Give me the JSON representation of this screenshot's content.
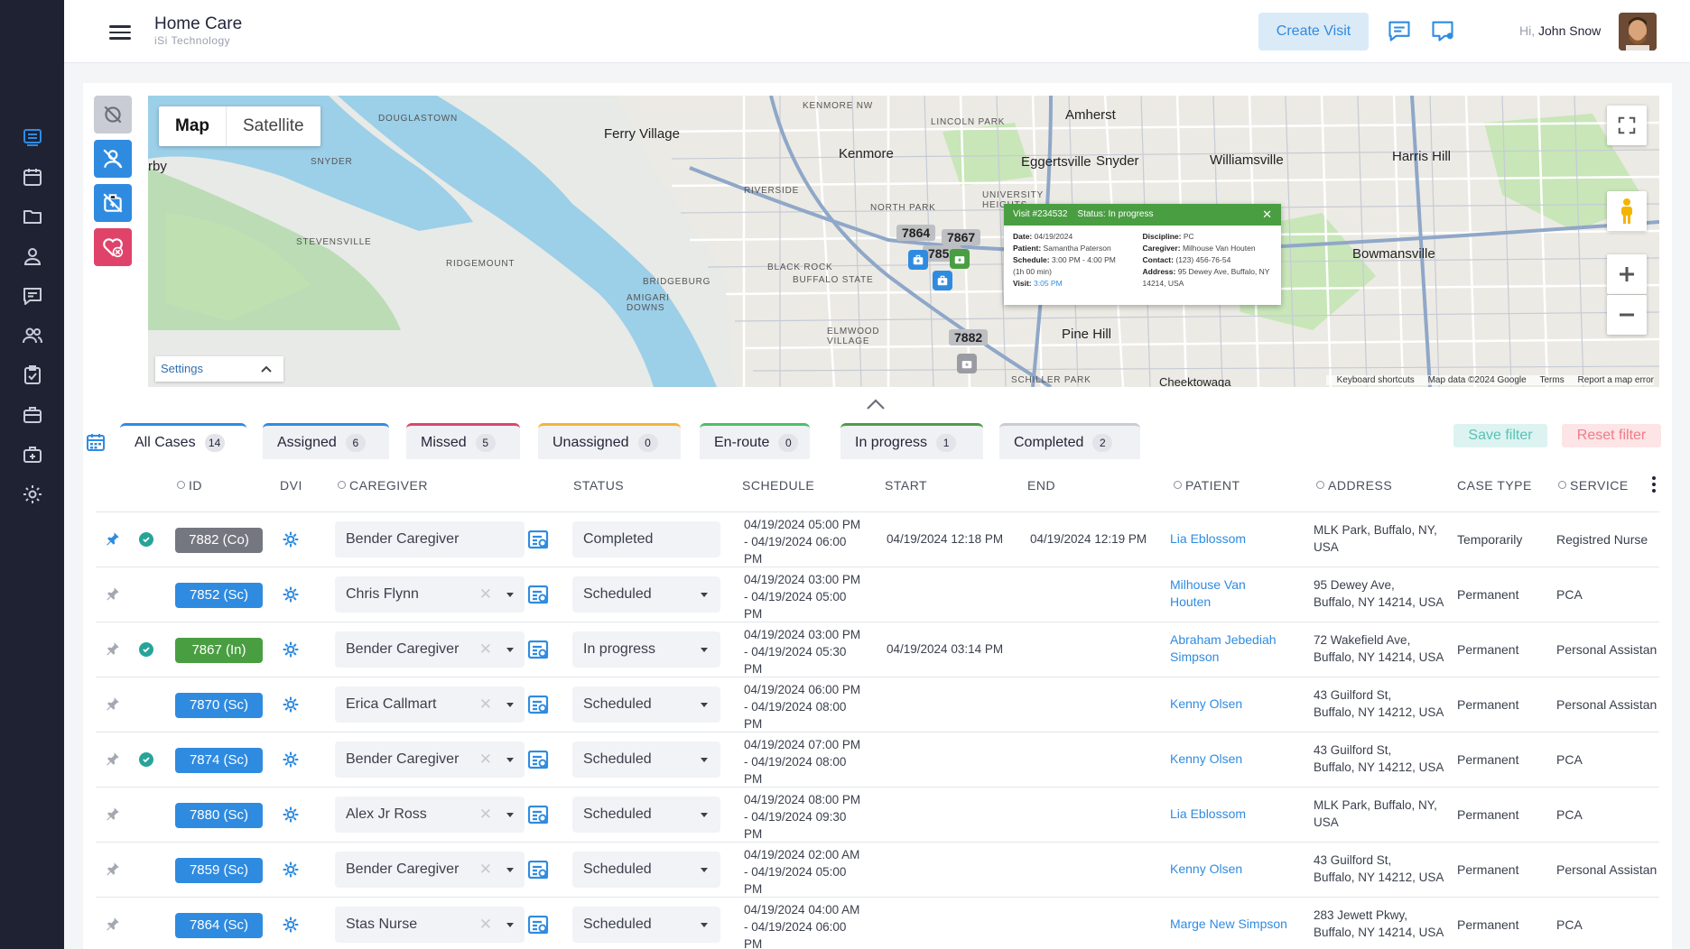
{
  "app": {
    "title": "Home Care",
    "subtitle": "iSi Technology"
  },
  "header": {
    "create_visit": "Create Visit",
    "greeting": "Hi,",
    "user_name": "John Snow"
  },
  "colors": {
    "sidebar_bg": "#1f2233",
    "accent": "#2f8be0",
    "completed": "#757780",
    "scheduled": "#2f8be0",
    "in_progress": "#4a9e42"
  },
  "sidebar": {
    "items": [
      {
        "icon": "chat-list-icon",
        "active": true
      },
      {
        "icon": "calendar-icon"
      },
      {
        "icon": "folder-icon"
      },
      {
        "icon": "user-icon"
      },
      {
        "icon": "messages-icon"
      },
      {
        "icon": "users-icon"
      },
      {
        "icon": "clipboard-check-icon"
      },
      {
        "icon": "briefcase-icon"
      },
      {
        "icon": "medical-kit-icon"
      },
      {
        "icon": "gear-icon"
      }
    ]
  },
  "map": {
    "type_map": "Map",
    "type_satellite": "Satellite",
    "settings": "Settings",
    "labels": [
      "Ferry Village",
      "Kenmore",
      "Amherst",
      "Eggertsville",
      "Snyder",
      "Williamsville",
      "Harris Hill",
      "Bowmansville",
      "Pine Hill",
      "Cheektowaga",
      "rby"
    ],
    "small_labels": [
      "DOUGLASTOWN",
      "SNYDER",
      "STEVENSVILLE",
      "RIDGEMOUNT",
      "BRIDGEBURG",
      "AMIGARI DOWNS",
      "KENMORE NW",
      "LINCOLN PARK",
      "RIVERSIDE",
      "NORTH PARK",
      "UNIVERSITY HEIGHTS",
      "BLACK ROCK",
      "BUFFALO STATE",
      "ELMWOOD VILLAGE",
      "SCHILLER PARK"
    ],
    "markers": [
      "7864",
      "7867",
      "7852",
      "7882"
    ],
    "attribution": [
      "Keyboard shortcuts",
      "Map data ©2024 Google",
      "Terms",
      "Report a map error"
    ],
    "popup": {
      "title": "Visit #234532",
      "status": "Status: In progress",
      "date_label": "Date:",
      "date": "04/19/2024",
      "patient_label": "Patient:",
      "patient": "Samantha Paterson",
      "schedule_label": "Schedule:",
      "schedule": "3:00 PM - 4:00 PM",
      "duration": "(1h 00 min)",
      "visit_label": "Visit:",
      "visit": "3:05 PM",
      "discipline_label": "Discipline:",
      "discipline": "PC",
      "caregiver_label": "Caregiver:",
      "caregiver": "Milhouse Van Houten",
      "contact_label": "Contact:",
      "contact": "(123) 456-76-54",
      "address_label": "Address:",
      "address": "95 Dewey Ave, Buffalo, NY 14214, USA"
    }
  },
  "tabs": [
    {
      "label": "All Cases",
      "count": "14",
      "color": "#2f8be0"
    },
    {
      "label": "Assigned",
      "count": "6",
      "color": "#2f8be0"
    },
    {
      "label": "Missed",
      "count": "5",
      "color": "#e0436a"
    },
    {
      "label": "Unassigned",
      "count": "0",
      "color": "#f2b632"
    },
    {
      "label": "En-route",
      "count": "0",
      "color": "#4bbf6b"
    },
    {
      "label": "In progress",
      "count": "1",
      "color": "#4a9e42"
    },
    {
      "label": "Completed",
      "count": "2",
      "color": "#c9ccd3"
    }
  ],
  "filters": {
    "save": "Save filter",
    "reset": "Reset filter"
  },
  "table": {
    "headers": {
      "id": "ID",
      "dvi": "DVI",
      "caregiver": "CAREGIVER",
      "status": "STATUS",
      "schedule": "SCHEDULE",
      "start": "START",
      "end": "END",
      "patient": "PATIENT",
      "address": "ADDRESS",
      "case_type": "CASE TYPE",
      "service": "SERVICE"
    },
    "rows": [
      {
        "pinned": true,
        "verified": true,
        "id": "7882 (Co)",
        "id_color": "#757780",
        "caregiver": "Bender Caregiver",
        "clearable": false,
        "status": "Completed",
        "status_dropdown": false,
        "schedule": [
          "04/19/2024 05:00 PM",
          "- 04/19/2024 06:00",
          "PM"
        ],
        "start": "04/19/2024 12:18 PM",
        "end": "04/19/2024 12:19 PM",
        "patient": [
          "Lia Eblossom"
        ],
        "address": [
          "MLK Park, Buffalo, NY,",
          "USA"
        ],
        "case_type": "Temporarily",
        "service": "Registred Nurse"
      },
      {
        "pinned": false,
        "verified": false,
        "id": "7852 (Sc)",
        "id_color": "#2f8be0",
        "caregiver": "Chris Flynn",
        "clearable": true,
        "status": "Scheduled",
        "status_dropdown": true,
        "schedule": [
          "04/19/2024 03:00 PM",
          "- 04/19/2024 05:00",
          "PM"
        ],
        "start": "",
        "end": "",
        "patient": [
          "Milhouse Van",
          "Houten"
        ],
        "address": [
          "95 Dewey Ave,",
          "Buffalo, NY 14214, USA"
        ],
        "case_type": "Permanent",
        "service": "PCA"
      },
      {
        "pinned": false,
        "verified": true,
        "id": "7867 (In)",
        "id_color": "#4a9e42",
        "caregiver": "Bender Caregiver",
        "clearable": true,
        "status": "In progress",
        "status_dropdown": true,
        "schedule": [
          "04/19/2024 03:00 PM",
          "- 04/19/2024 05:30",
          "PM"
        ],
        "start": "04/19/2024 03:14 PM",
        "end": "",
        "patient": [
          "Abraham Jebediah",
          "Simpson"
        ],
        "address": [
          "72 Wakefield Ave,",
          "Buffalo, NY 14214, USA"
        ],
        "case_type": "Permanent",
        "service": "Personal Assistan"
      },
      {
        "pinned": false,
        "verified": false,
        "id": "7870 (Sc)",
        "id_color": "#2f8be0",
        "caregiver": "Erica Callmart",
        "clearable": true,
        "status": "Scheduled",
        "status_dropdown": true,
        "schedule": [
          "04/19/2024 06:00 PM",
          "- 04/19/2024 08:00",
          "PM"
        ],
        "start": "",
        "end": "",
        "patient": [
          "Kenny Olsen"
        ],
        "address": [
          "43 Guilford St,",
          "Buffalo, NY 14212, USA"
        ],
        "case_type": "Permanent",
        "service": "Personal Assistan"
      },
      {
        "pinned": false,
        "verified": true,
        "id": "7874 (Sc)",
        "id_color": "#2f8be0",
        "caregiver": "Bender Caregiver",
        "clearable": true,
        "status": "Scheduled",
        "status_dropdown": true,
        "schedule": [
          "04/19/2024 07:00 PM",
          "- 04/19/2024 08:00",
          "PM"
        ],
        "start": "",
        "end": "",
        "patient": [
          "Kenny Olsen"
        ],
        "address": [
          "43 Guilford St,",
          "Buffalo, NY 14212, USA"
        ],
        "case_type": "Permanent",
        "service": "PCA"
      },
      {
        "pinned": false,
        "verified": false,
        "id": "7880 (Sc)",
        "id_color": "#2f8be0",
        "caregiver": "Alex Jr Ross",
        "clearable": true,
        "status": "Scheduled",
        "status_dropdown": true,
        "schedule": [
          "04/19/2024 08:00 PM",
          "- 04/19/2024 09:30",
          "PM"
        ],
        "start": "",
        "end": "",
        "patient": [
          "Lia Eblossom"
        ],
        "address": [
          "MLK Park, Buffalo, NY,",
          "USA"
        ],
        "case_type": "Permanent",
        "service": "PCA"
      },
      {
        "pinned": false,
        "verified": false,
        "id": "7859 (Sc)",
        "id_color": "#2f8be0",
        "caregiver": "Bender Caregiver",
        "clearable": true,
        "status": "Scheduled",
        "status_dropdown": true,
        "schedule": [
          "04/19/2024 02:00 AM",
          "- 04/19/2024 05:00",
          "PM"
        ],
        "start": "",
        "end": "",
        "patient": [
          "Kenny Olsen"
        ],
        "address": [
          "43 Guilford St,",
          "Buffalo, NY 14212, USA"
        ],
        "case_type": "Permanent",
        "service": "Personal Assistan"
      },
      {
        "pinned": false,
        "verified": false,
        "id": "7864 (Sc)",
        "id_color": "#2f8be0",
        "caregiver": "Stas Nurse",
        "clearable": true,
        "status": "Scheduled",
        "status_dropdown": true,
        "schedule": [
          "04/19/2024 04:00 AM",
          "- 04/19/2024 06:00",
          "PM"
        ],
        "start": "",
        "end": "",
        "patient": [
          "Marge New Simpson"
        ],
        "address": [
          "283 Jewett Pkwy,",
          "Buffalo, NY 14214, USA"
        ],
        "case_type": "Permanent",
        "service": "PCA"
      }
    ]
  }
}
